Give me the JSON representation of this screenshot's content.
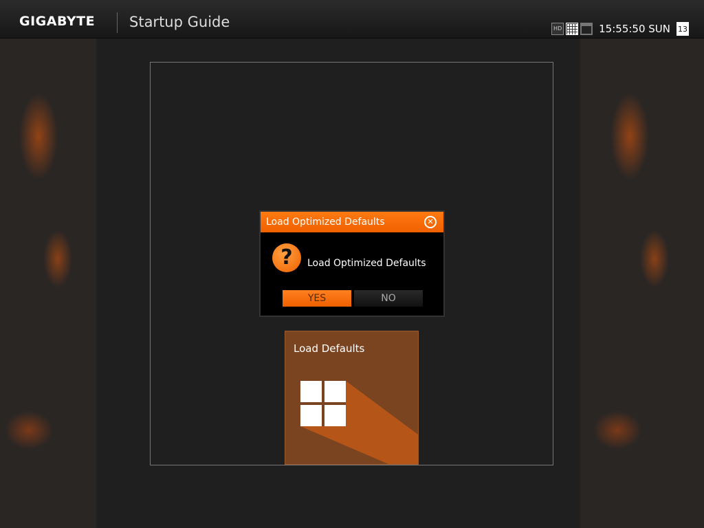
{
  "header": {
    "brand": "GIGABYTE",
    "title": "Startup Guide",
    "hd_icon": "HD",
    "time": "15:55:50 SUN",
    "calendar_day": "13"
  },
  "dialog": {
    "title": "Load Optimized Defaults",
    "message": "Load Optimized Defaults",
    "yes": "YES",
    "no": "NO"
  },
  "tile": {
    "label": "Load Defaults"
  }
}
